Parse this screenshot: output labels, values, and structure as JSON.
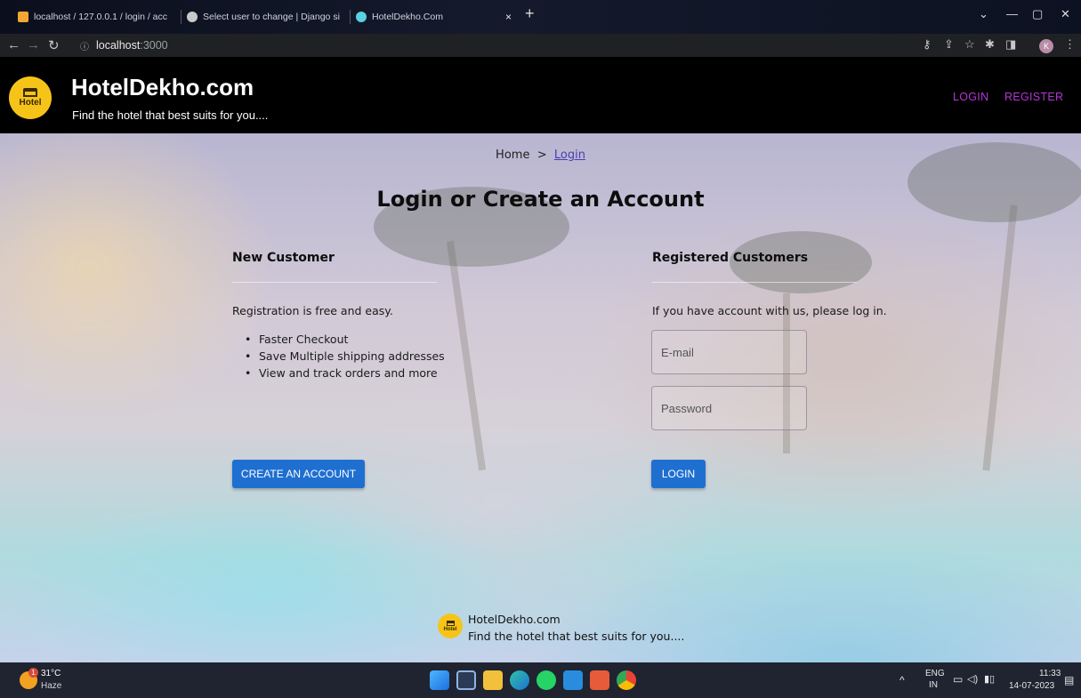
{
  "browser": {
    "tabs": [
      {
        "label": "localhost / 127.0.0.1 / login / acc"
      },
      {
        "label": "Select user to change | Django si"
      },
      {
        "label": "HotelDekho.Com"
      }
    ],
    "address": {
      "host": "localhost",
      "port": ":3000"
    },
    "profile_initial": "K"
  },
  "header": {
    "logo_text": "Hotel",
    "title": "HotelDekho.com",
    "tagline": "Find the hotel that best suits for you....",
    "nav": {
      "login": "LOGIN",
      "register": "REGISTER"
    }
  },
  "breadcrumb": {
    "home": "Home",
    "separator": ">",
    "current": "Login"
  },
  "page_title": "Login or Create an Account",
  "new_customer": {
    "heading": "New Customer",
    "intro": "Registration is free and easy.",
    "benefits": [
      "Faster Checkout",
      "Save Multiple shipping addresses",
      "View and track orders and more"
    ],
    "button": "CREATE AN ACCOUNT"
  },
  "registered": {
    "heading": "Registered Customers",
    "intro": "If you have account with us, please log in.",
    "email_placeholder": "E-mail",
    "password_placeholder": "Password",
    "button": "LOGIN"
  },
  "footer": {
    "logo_text": "Hotel",
    "brand": "HotelDekho.com",
    "tagline": "Find the hotel that best suits for you...."
  },
  "taskbar": {
    "weather_temp": "31°C",
    "weather_desc": "Haze",
    "weather_badge": "1",
    "lang_top": "ENG",
    "lang_bottom": "IN",
    "time": "11:33",
    "date": "14-07-2023"
  },
  "colors": {
    "brand_yellow": "#f6c419",
    "nav_purple": "#b437d6",
    "button_blue": "#1f6fd1"
  }
}
